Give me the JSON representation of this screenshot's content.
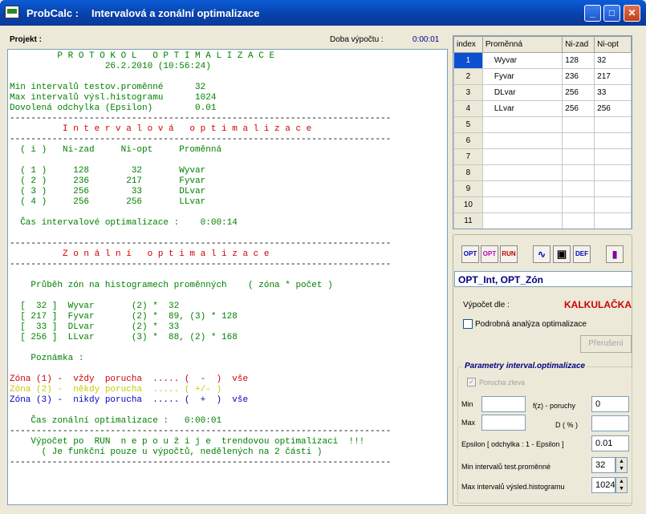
{
  "title": {
    "app": "ProbCalc :",
    "subtitle": "Intervalová a zonální optimalizace"
  },
  "header": {
    "projekt": "Projekt :",
    "doba": "Doba výpočtu :",
    "time": "0:00:01"
  },
  "protocol": {
    "lines": [
      {
        "t": "         P R O T O K O L   O P T I M A L I Z A C E",
        "c": "g"
      },
      {
        "t": "                  26.2.2010 (10:56:24)",
        "c": "g"
      },
      {
        "t": "",
        "c": "k"
      },
      {
        "t": "Min intervalů testov.proměnné      32",
        "c": "g"
      },
      {
        "t": "Max intervalů výsl.histogramu      1024",
        "c": "g"
      },
      {
        "t": "Dovolená odchylka (Epsilon)        0.01",
        "c": "g"
      },
      {
        "t": "------------------------------------------------------------------------",
        "c": "k"
      },
      {
        "t": "          I n t e r v a l o v á   o p t i m a l i z a c e",
        "c": "r"
      },
      {
        "t": "------------------------------------------------------------------------",
        "c": "k"
      },
      {
        "t": "  ( i )   Ni-zad     Ni-opt     Proměnná",
        "c": "g"
      },
      {
        "t": "",
        "c": "k"
      },
      {
        "t": "  ( 1 )     128        32       Wyvar",
        "c": "g"
      },
      {
        "t": "  ( 2 )     236       217       Fyvar",
        "c": "g"
      },
      {
        "t": "  ( 3 )     256        33       DLvar",
        "c": "g"
      },
      {
        "t": "  ( 4 )     256       256       LLvar",
        "c": "g"
      },
      {
        "t": "",
        "c": "k"
      },
      {
        "t": "  Čas intervalové optimalizace :    0:00:14",
        "c": "g"
      },
      {
        "t": "",
        "c": "k"
      },
      {
        "t": "------------------------------------------------------------------------",
        "c": "k"
      },
      {
        "t": "          Z o n á l n í   o p t i m a l i z a c e",
        "c": "r"
      },
      {
        "t": "------------------------------------------------------------------------",
        "c": "k"
      },
      {
        "t": "",
        "c": "k"
      },
      {
        "t": "    Průběh zón na histogramech proměnných    ( zóna * počet )",
        "c": "g"
      },
      {
        "t": "",
        "c": "k"
      },
      {
        "t": "  [  32 ]  Wyvar       (2) *  32",
        "c": "g"
      },
      {
        "t": "  [ 217 ]  Fyvar       (2) *  89, (3) * 128",
        "c": "g"
      },
      {
        "t": "  [  33 ]  DLvar       (2) *  33",
        "c": "g"
      },
      {
        "t": "  [ 256 ]  LLvar       (3) *  88, (2) * 168",
        "c": "g"
      },
      {
        "t": "",
        "c": "k"
      },
      {
        "t": "    Poznámka :",
        "c": "g"
      },
      {
        "t": "",
        "c": "k"
      },
      {
        "t": "Zóna (1) -  vždy  porucha  ..... (  -  )  vše",
        "c": "r"
      },
      {
        "t": "Zóna (2) -  někdy porucha  ..... ( +/- )",
        "c": "y"
      },
      {
        "t": "Zóna (3) -  nikdy porucha  ..... (  +  )  vše",
        "c": "b"
      },
      {
        "t": "",
        "c": "k"
      },
      {
        "t": "    Čas zonální optimalizace :   0:00:01",
        "c": "g"
      },
      {
        "t": "------------------------------------------------------------------------",
        "c": "k"
      },
      {
        "t": "    Výpočet po  RUN  n e p o u ž i j e  trendovou optimalizaci  !!!",
        "c": "g"
      },
      {
        "t": "      ( Je funkční pouze u výpočtů, nedělených na 2 části )",
        "c": "g"
      },
      {
        "t": "------------------------------------------------------------------------",
        "c": "k"
      }
    ]
  },
  "grid": {
    "headers": [
      "index",
      "Proměnná",
      "Ni-zad",
      "Ni-opt"
    ],
    "rows": [
      [
        "1",
        "Wyvar",
        "128",
        "32"
      ],
      [
        "2",
        "Fyvar",
        "236",
        "217"
      ],
      [
        "3",
        "DLvar",
        "256",
        "33"
      ],
      [
        "4",
        "LLvar",
        "256",
        "256"
      ],
      [
        "5",
        "",
        "",
        ""
      ],
      [
        "6",
        "",
        "",
        ""
      ],
      [
        "7",
        "",
        "",
        ""
      ],
      [
        "8",
        "",
        "",
        ""
      ],
      [
        "9",
        "",
        "",
        ""
      ],
      [
        "10",
        "",
        "",
        ""
      ],
      [
        "11",
        "",
        "",
        ""
      ]
    ]
  },
  "toolbar": {
    "opt_i": "OPT",
    "opt_z": "OPT",
    "run": "RUN",
    "def": "DEF"
  },
  "panel": {
    "mode": "OPT_Int,    OPT_Zón",
    "vypocet_label": "Výpočet dle :",
    "vypocet_value": "KALKULAČKA",
    "podrobna": "Podrobná analýza optimalizace",
    "preruseni": "Přerušení",
    "params_title": "Parametry interval.optimalizace",
    "porucha": "Porucha zleva",
    "min": "Min",
    "max": "Max",
    "fz": "f(z) - poruchy",
    "fz_value": "0",
    "d": "D ( % )",
    "eps_label": "Epsilon [ odchylka : 1 - Epsilon ]",
    "eps_value": "0.01",
    "minint_label": "Min  intervalů test.proměnné",
    "minint_value": "32",
    "maxint_label": "Max intervalů výsled.histogramu",
    "maxint_value": "1024"
  }
}
